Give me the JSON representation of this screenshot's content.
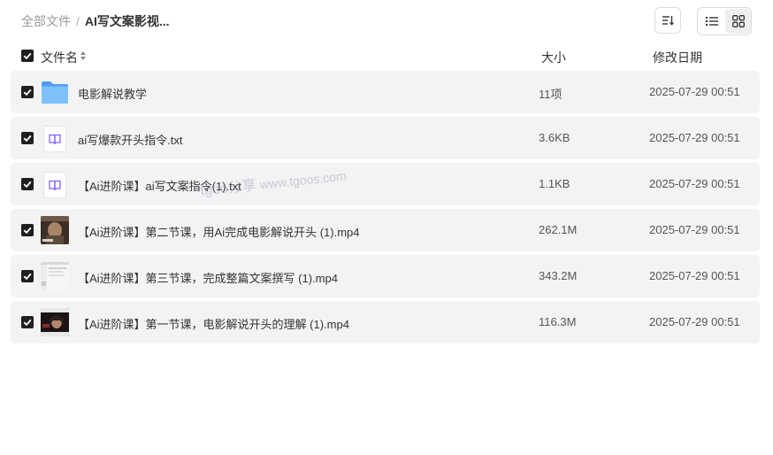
{
  "breadcrumb": {
    "root": "全部文件",
    "separator": "/",
    "current": "AI写文案影视..."
  },
  "toolbar": {
    "sort_icon": "sort-icon",
    "list_view_icon": "list-view-icon",
    "grid_view_icon": "grid-view-icon",
    "active_view": "grid"
  },
  "table": {
    "headers": {
      "name": "文件名",
      "size": "大小",
      "date": "修改日期"
    },
    "rows": [
      {
        "name": "电影解说教学",
        "size": "11项",
        "date": "2025-07-29 00:51",
        "type": "folder",
        "checked": true
      },
      {
        "name": "ai写爆款开头指令.txt",
        "size": "3.6KB",
        "date": "2025-07-29 00:51",
        "type": "txt",
        "checked": true
      },
      {
        "name": "【Ai进阶课】ai写文案指令(1).txt",
        "size": "1.1KB",
        "date": "2025-07-29 00:51",
        "type": "txt",
        "checked": true
      },
      {
        "name": "【Ai进阶课】第二节课，用Ai完成电影解说开头 (1).mp4",
        "size": "262.1M",
        "date": "2025-07-29 00:51",
        "type": "video",
        "checked": true
      },
      {
        "name": "【Ai进阶课】第三节课，完成整篇文案撰写 (1).mp4",
        "size": "343.2M",
        "date": "2025-07-29 00:51",
        "type": "video",
        "checked": true
      },
      {
        "name": "【Ai进阶课】第一节课，电影解说开头的理解 (1).mp4",
        "size": "116.3M",
        "date": "2025-07-29 00:51",
        "type": "video",
        "checked": true
      }
    ]
  },
  "watermark": {
    "text1": "tgoo分享",
    "text2": "www.tgoos.com"
  },
  "colors": {
    "row_bg": "#f3f3f3",
    "checkbox": "#1f1f1f",
    "folder": "#5aa9f5",
    "txt_accent": "#7b61ff"
  }
}
